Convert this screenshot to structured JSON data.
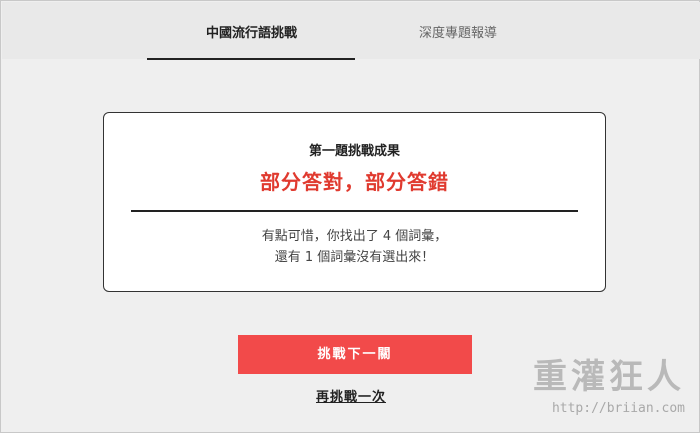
{
  "tabs": {
    "active_label": "中國流行語挑戰",
    "inactive_label": "深度專題報導"
  },
  "card": {
    "label": "第一題挑戰成果",
    "result": "部分答對，部分答錯",
    "message_line1": "有點可惜，你找出了 4 個詞彙，",
    "message_line2": "還有 1 個詞彙沒有選出來！"
  },
  "actions": {
    "next_label": "挑戰下一關",
    "retry_label": "再挑戰一次"
  },
  "watermark": {
    "logo_text": "重灌狂人",
    "url_text": "http://briian.com"
  },
  "colors": {
    "accent_red": "#e03a2f",
    "button_red": "#f24a4a",
    "page_bg": "#efefef"
  }
}
